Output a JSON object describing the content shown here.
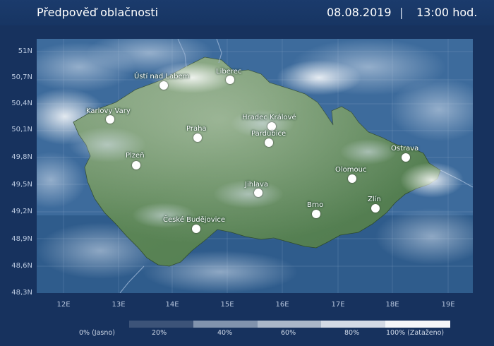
{
  "header": {
    "title": "Předpověď oblačnosti",
    "date": "08.08.2019",
    "separator": "|",
    "time": "13:00 hod."
  },
  "map": {
    "lat_labels": [
      "51N",
      "50,7N",
      "50,4N",
      "50,1N",
      "49,8N",
      "49,5N",
      "49,2N",
      "48,9N",
      "48,6N",
      "48,3N"
    ],
    "lon_labels": [
      "12E",
      "13E",
      "14E",
      "15E",
      "16E",
      "17E",
      "18E",
      "19E"
    ],
    "cities": [
      {
        "name": "Liberec"
      },
      {
        "name": "Ústí nad Labem"
      },
      {
        "name": "Karlovy Vary"
      },
      {
        "name": "Hradec Králové"
      },
      {
        "name": "Pardubice"
      },
      {
        "name": "Praha"
      },
      {
        "name": "Plzeň"
      },
      {
        "name": "Ostrava"
      },
      {
        "name": "Olomouc"
      },
      {
        "name": "Jihlava"
      },
      {
        "name": "Brno"
      },
      {
        "name": "Zlín"
      },
      {
        "name": "České Budějovice"
      }
    ]
  },
  "legend": {
    "labels": [
      "0% (Jasno)",
      "20%",
      "40%",
      "60%",
      "80%",
      "100% (Zataženo)"
    ],
    "colors": [
      "#3c5378",
      "#5c7192",
      "#8193ad",
      "#aab7c9",
      "#d3dae5",
      "#f4f6f9"
    ]
  }
}
